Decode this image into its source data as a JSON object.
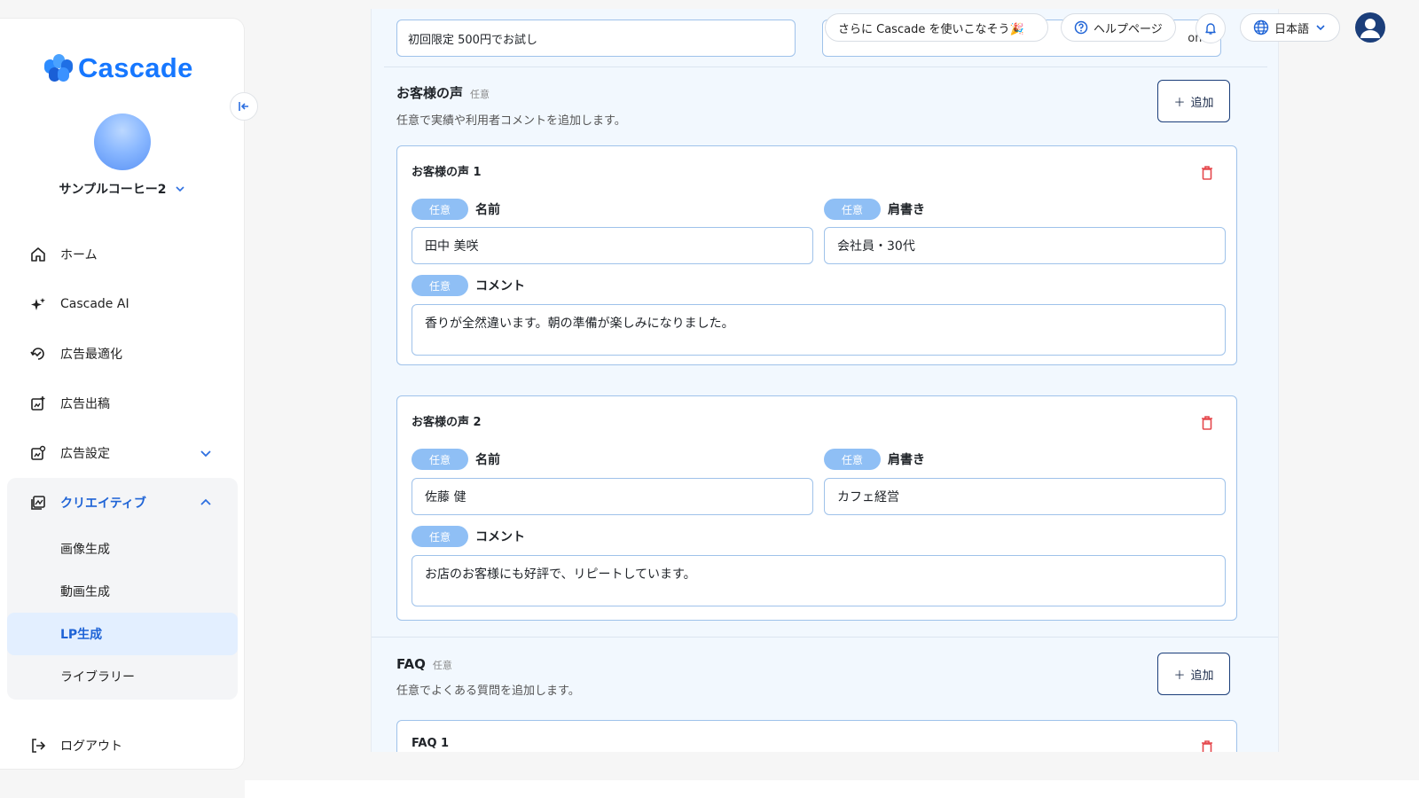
{
  "brand": {
    "name": "Cascade",
    "color": "#1677ff"
  },
  "account": {
    "name": "サンプルコーヒー2"
  },
  "nav": {
    "home": "ホーム",
    "ai": "Cascade AI",
    "ad_optimize": "広告最適化",
    "ad_post": "広告出稿",
    "ad_settings": "広告設定",
    "creative": "クリエイティブ",
    "sub": {
      "image": "画像生成",
      "video": "動画生成",
      "lp": "LP生成",
      "library": "ライブラリー"
    },
    "logout": "ログアウト"
  },
  "header": {
    "promo": "さらに Cascade を使いこなそう🎉",
    "help": "ヘルプページ",
    "language": "日本語"
  },
  "top_inputs": {
    "left_value": "初回限定 500円でお試し",
    "right_value": "om,"
  },
  "testimonials": {
    "title": "お客様の声",
    "optional": "任意",
    "desc": "任意で実績や利用者コメントを追加します。",
    "add_label": "追加",
    "badge": "任意",
    "name_label": "名前",
    "position_label": "肩書き",
    "comment_label": "コメント",
    "items": [
      {
        "title": "お客様の声 1",
        "name": "田中 美咲",
        "position": "会社員・30代",
        "comment": "香りが全然違います。朝の準備が楽しみになりました。"
      },
      {
        "title": "お客様の声 2",
        "name": "佐藤 健",
        "position": "カフェ経営",
        "comment": "お店のお客様にも好評で、リピートしています。"
      }
    ]
  },
  "faq": {
    "title": "FAQ",
    "optional": "任意",
    "desc": "任意でよくある質問を追加します。",
    "add_label": "追加",
    "items": [
      {
        "title": "FAQ 1"
      }
    ]
  },
  "icons": {
    "home": "home-icon",
    "ai": "sparkle-icon",
    "optimize": "optimize-icon",
    "post": "ad-post-icon",
    "settings": "ad-settings-icon",
    "creative": "creative-icon",
    "logout": "logout-icon",
    "trash": "trash-icon",
    "help": "help-icon",
    "bell": "bell-icon",
    "globe": "globe-icon",
    "user": "user-icon"
  },
  "colors": {
    "accent": "#1e63d6",
    "danger": "#e5484d",
    "badge": "#8fbff5",
    "panel": "#f2f8fe"
  }
}
